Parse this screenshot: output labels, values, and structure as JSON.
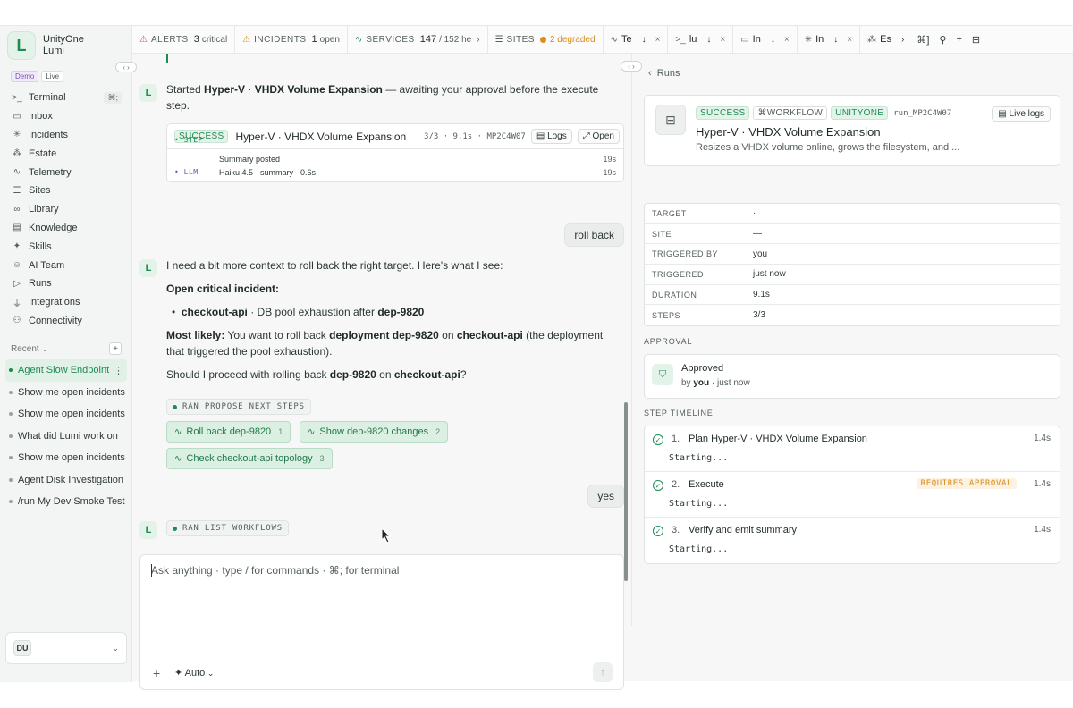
{
  "brand": {
    "name_line1": "UnityOne",
    "name_line2": "Lumi",
    "logo_letter": "L",
    "badge_demo": "Demo",
    "badge_live": "Live"
  },
  "sidebar": {
    "items": [
      {
        "label": "Terminal",
        "icon": "terminal-icon",
        "glyph": ">_",
        "kbd": "⌘;"
      },
      {
        "label": "Inbox",
        "icon": "inbox-icon",
        "glyph": "▭"
      },
      {
        "label": "Incidents",
        "icon": "incident-icon",
        "glyph": "✳"
      },
      {
        "label": "Estate",
        "icon": "estate-icon",
        "glyph": "⁂"
      },
      {
        "label": "Telemetry",
        "icon": "pulse-icon",
        "glyph": "∿"
      },
      {
        "label": "Sites",
        "icon": "server-icon",
        "glyph": "☰"
      },
      {
        "label": "Library",
        "icon": "link-icon",
        "glyph": "∞"
      },
      {
        "label": "Knowledge",
        "icon": "book-icon",
        "glyph": "▤"
      },
      {
        "label": "Skills",
        "icon": "sparkle-icon",
        "glyph": "✦"
      },
      {
        "label": "AI Team",
        "icon": "bot-icon",
        "glyph": "☺"
      },
      {
        "label": "Runs",
        "icon": "play-icon",
        "glyph": "▷"
      },
      {
        "label": "Integrations",
        "icon": "plug-icon",
        "glyph": "⏚"
      },
      {
        "label": "Connectivity",
        "icon": "network-icon",
        "glyph": "⚇"
      }
    ],
    "recent_label": "Recent",
    "recent": [
      "Agent Slow Endpoint",
      "Show me open incidents",
      "Show me open incidents",
      "What did Lumi work on",
      "Show me open incidents",
      "Agent Disk Investigation",
      "/run My Dev Smoke Test"
    ],
    "user_initials": "DU"
  },
  "topbar": {
    "alerts": {
      "label": "ALERTS",
      "value": "3",
      "suffix": "critical"
    },
    "incidents": {
      "label": "INCIDENTS",
      "value": "1",
      "suffix": "open"
    },
    "services": {
      "label": "SERVICES",
      "value": "147",
      "suffix": "/ 152 he"
    },
    "sites": {
      "label": "SITES",
      "suffix": "2 degraded"
    },
    "tabs": [
      "Te",
      "lu",
      "In",
      "In",
      "Es"
    ]
  },
  "chat": {
    "msg1_pre": "Started ",
    "msg1_bold": "Hyper-V · VHDX Volume Expansion",
    "msg1_post": " — awaiting your approval before the execute step.",
    "wf_card": {
      "status": "SUCCESS",
      "title": "Hyper-V · VHDX Volume Expansion",
      "meta": "3/3 · 9.1s · MP2C4W07",
      "logs": "Logs",
      "open": "Open",
      "line1": {
        "kind": "STEP",
        "text": "Summary posted",
        "time": "19s"
      },
      "line2": {
        "kind": "LLM",
        "text": "Haiku 4.5 · summary · 0.6s",
        "time": "19s"
      }
    },
    "user1": "roll back",
    "msg2": {
      "intro": "I need a bit more context to roll back the right target. Here's what I see:",
      "heading": "Open critical incident:",
      "bullet_bold": "checkout-api",
      "bullet_rest": " · DB pool exhaustion after ",
      "bullet_dep": "dep-9820",
      "likely_label": "Most likely:",
      "likely_1": " You want to roll back ",
      "likely_2": "deployment dep-9820",
      "likely_3": " on ",
      "likely_4": "checkout-api",
      "likely_5": " (the deployment that triggered the pool exhaustion).",
      "q_1": "Should I proceed with rolling back ",
      "q_2": "dep-9820",
      "q_3": " on ",
      "q_4": "checkout-api",
      "q_5": "?"
    },
    "ran1": "RAN PROPOSE NEXT STEPS",
    "suggestions": [
      {
        "label": "Roll back dep-9820",
        "n": "1"
      },
      {
        "label": "Show dep-9820 changes",
        "n": "2"
      },
      {
        "label": "Check checkout-api topology",
        "n": "3"
      }
    ],
    "user2": "yes",
    "ran2": "RAN LIST WORKFLOWS",
    "composer_placeholder": "Ask anything · type / for commands · ⌘; for terminal",
    "auto_label": "Auto"
  },
  "right": {
    "back": "Runs",
    "tags": [
      "SUCCESS",
      "WORKFLOW",
      "UNITYONE"
    ],
    "run_id": "run_MP2C4W07",
    "live_logs": "Live logs",
    "title": "Hyper-V · VHDX Volume Expansion",
    "desc": "Resizes a VHDX volume online, grows the filesystem, and ...",
    "props": [
      {
        "k": "TARGET",
        "v": "·"
      },
      {
        "k": "SITE",
        "v": "—"
      },
      {
        "k": "TRIGGERED BY",
        "v": "you"
      },
      {
        "k": "TRIGGERED",
        "v": "just now"
      },
      {
        "k": "DURATION",
        "v": "9.1s"
      },
      {
        "k": "STEPS",
        "v": "3/3"
      }
    ],
    "approval_label": "APPROVAL",
    "approved": "Approved",
    "approved_by_pre": "by ",
    "approved_by": "you",
    "approved_by_post": " · just now",
    "timeline_label": "STEP TIMELINE",
    "steps": [
      {
        "num": "1.",
        "name": "Plan Hyper-V · VHDX Volume Expansion",
        "dur": "1.4s",
        "sub": "Starting..."
      },
      {
        "num": "2.",
        "name": "Execute",
        "dur": "1.4s",
        "sub": "Starting...",
        "badge": "REQUIRES APPROVAL"
      },
      {
        "num": "3.",
        "name": "Verify and emit summary",
        "dur": "1.4s",
        "sub": "Starting..."
      }
    ]
  }
}
